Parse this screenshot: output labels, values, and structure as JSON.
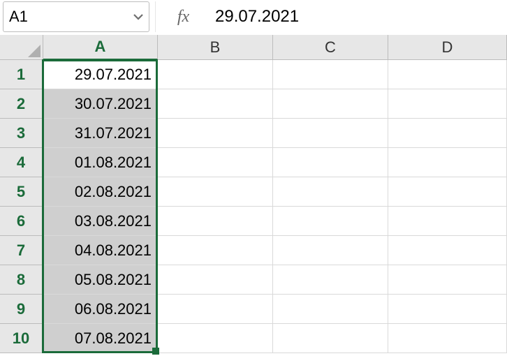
{
  "formula_bar": {
    "name_box": "A1",
    "fx_label": "fx",
    "formula_value": "29.07.2021"
  },
  "columns": [
    "A",
    "B",
    "C",
    "D"
  ],
  "rows": [
    "1",
    "2",
    "3",
    "4",
    "5",
    "6",
    "7",
    "8",
    "9",
    "10"
  ],
  "cells": {
    "A": [
      "29.07.2021",
      "30.07.2021",
      "31.07.2021",
      "01.08.2021",
      "02.08.2021",
      "03.08.2021",
      "04.08.2021",
      "05.08.2021",
      "06.08.2021",
      "07.08.2021"
    ]
  },
  "selection": {
    "active_cell": "A1",
    "range": "A1:A10",
    "selected_column": "A",
    "selected_rows_all": true
  },
  "colors": {
    "selection_border": "#1b6b3a",
    "header_bg": "#e7e7e7",
    "range_fill": "#cfcfcf"
  }
}
